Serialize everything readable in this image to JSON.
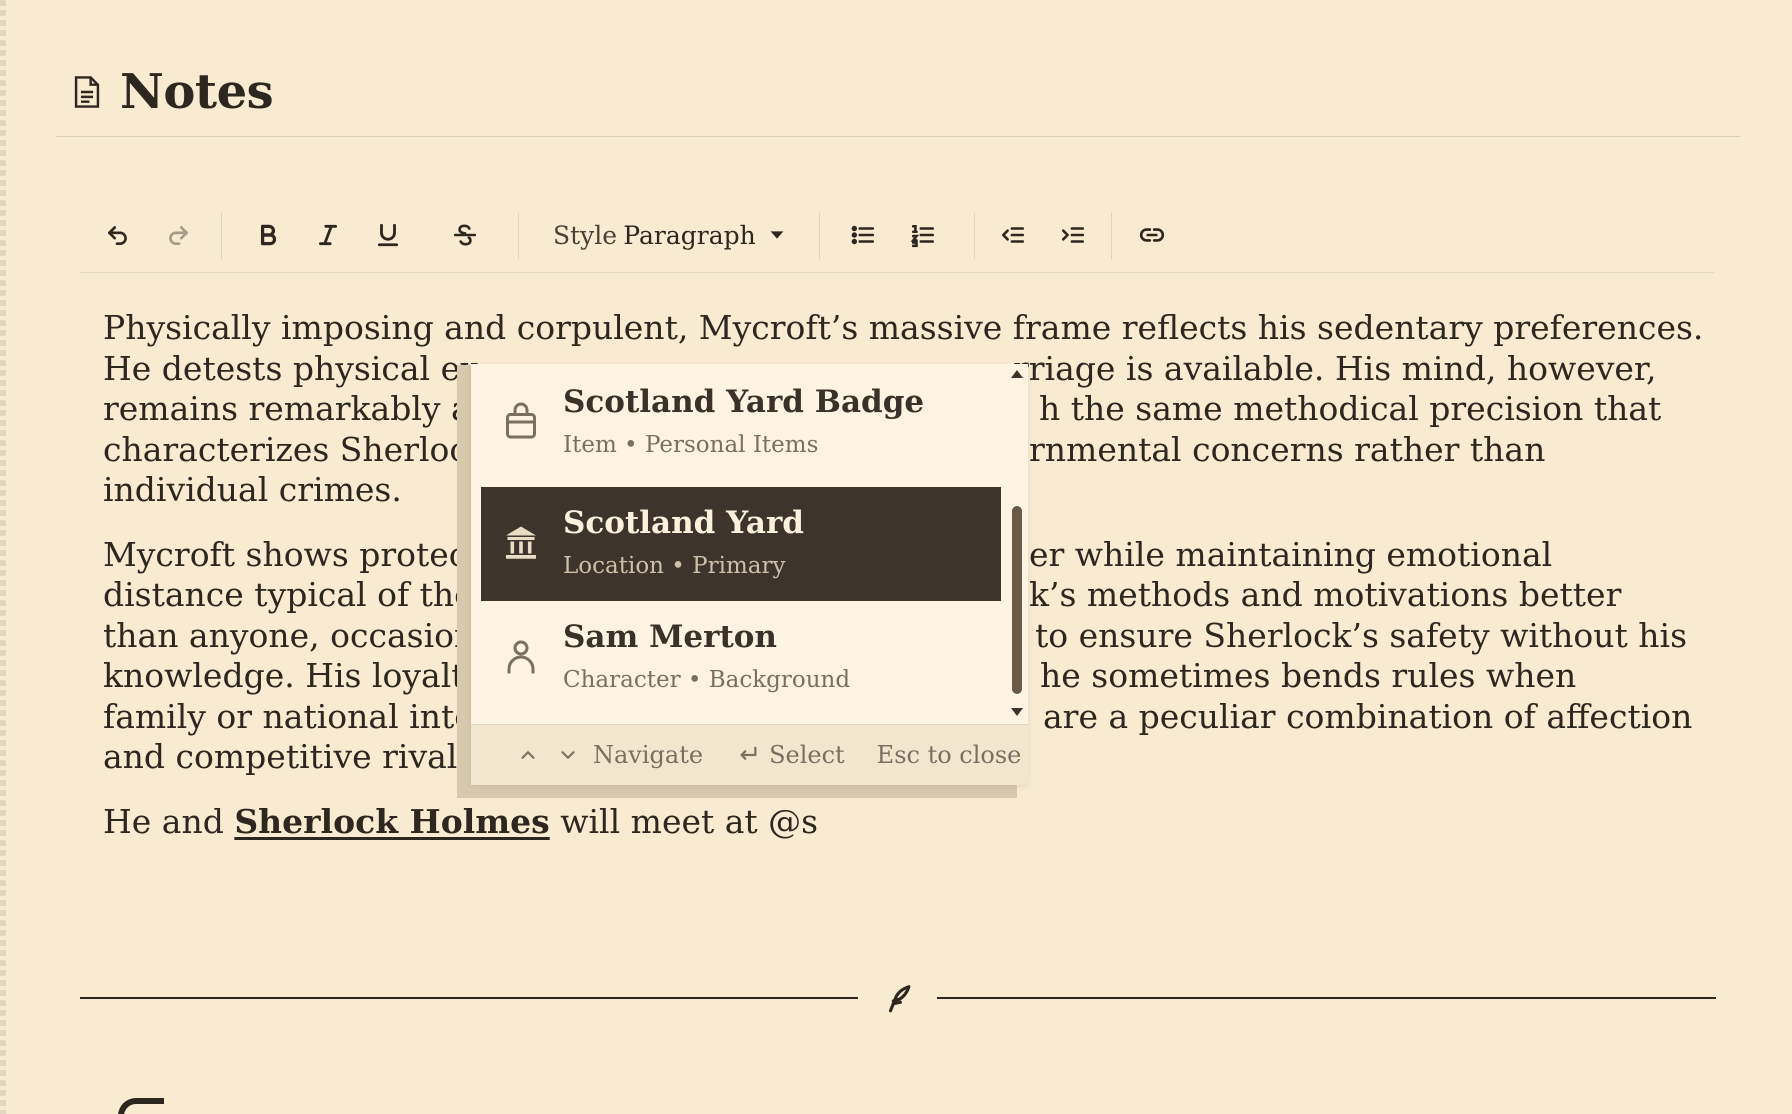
{
  "header": {
    "title": "Notes"
  },
  "toolbar": {
    "style_label": "Style",
    "block_format": "Paragraph",
    "buttons": [
      "undo-icon",
      "redo-icon",
      "bold-icon",
      "italic-icon",
      "underline-icon",
      "strikethrough-icon",
      "bullet-list-icon",
      "numbered-list-icon",
      "outdent-icon",
      "indent-icon",
      "link-icon"
    ]
  },
  "content": {
    "paragraphs": [
      [
        "Physically imposing and corpulent, Mycroft’s massive frame reflects his sedentary preferences.",
        "He detests physical ex",
        "rriage is available. His mind, however,",
        "remains remarkably a",
        "h the same methodical precision that",
        "characterizes Sherlock",
        "rnmental concerns rather than",
        "individual crimes."
      ],
      [
        "Mycroft shows protect",
        "er while maintaining emotional",
        "distance typical of the",
        "k’s methods and motivations better",
        "than anyone, occasion",
        "to ensure Sherlock’s safety without his",
        "knowledge. His loyalty",
        "he sometimes bends rules when",
        "family or national inte",
        "are a peculiar combination of affection",
        "and competitive rivalr"
      ]
    ],
    "last_line": {
      "before": "He and ",
      "mention": "Sherlock Holmes",
      "after": " will meet at @s"
    }
  },
  "mention_popup": {
    "options": [
      {
        "title": "Scotland Yard Badge",
        "subtitle": "Item • Personal Items",
        "icon": "bag-icon",
        "selected": false
      },
      {
        "title": "Scotland Yard",
        "subtitle": "Location • Primary",
        "icon": "building-icon",
        "selected": true
      },
      {
        "title": "Sam Merton",
        "subtitle": "Character • Background",
        "icon": "person-icon",
        "selected": false
      }
    ],
    "footer": {
      "navigate": "Navigate",
      "select": "Select",
      "close": "Esc to close"
    }
  },
  "colors": {
    "background": "#f8ebd2",
    "text": "#2e271f",
    "selected_bg": "#3d352c",
    "popup_bg": "#fdf4e3"
  }
}
